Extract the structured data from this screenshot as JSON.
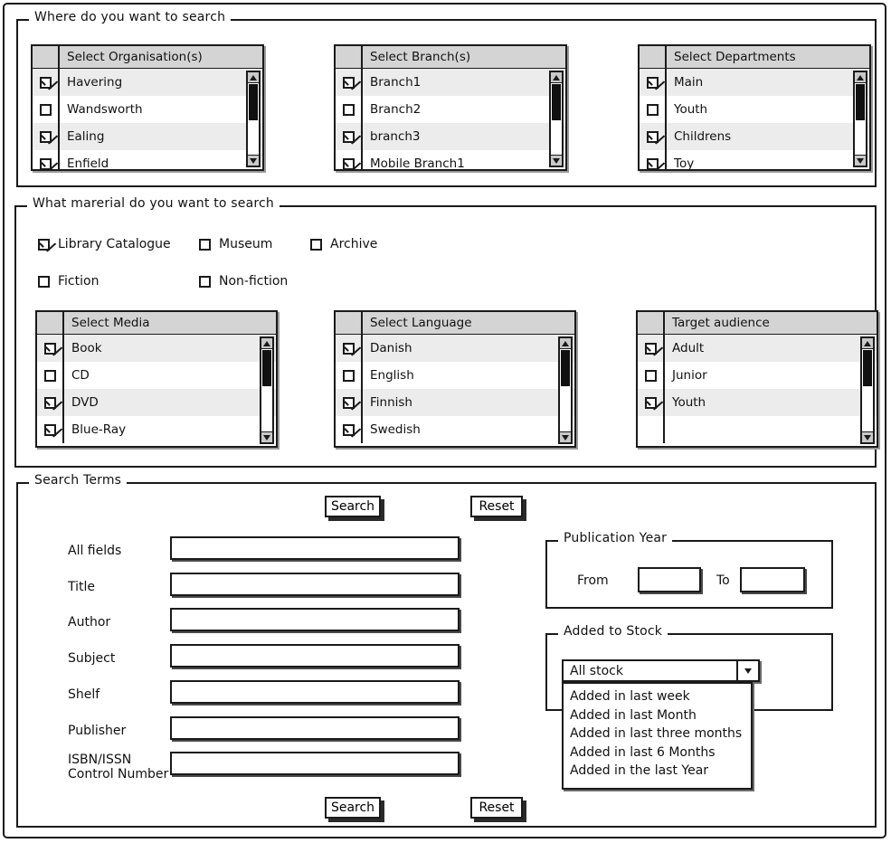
{
  "sections": {
    "where": {
      "legend": "Where do you want to search"
    },
    "material": {
      "legend": "What marerial do you want to search"
    },
    "terms": {
      "legend": "Search Terms"
    },
    "pubyear": {
      "legend": "Publication Year"
    },
    "addedstock": {
      "legend": "Added to Stock"
    }
  },
  "lists": {
    "organisations": {
      "header": "Select Organisation(s)",
      "rows": [
        {
          "label": "Havering",
          "checked": true
        },
        {
          "label": "Wandsworth",
          "checked": false
        },
        {
          "label": "Ealing",
          "checked": true
        },
        {
          "label": "Enfield",
          "checked": true
        }
      ]
    },
    "branches": {
      "header": "Select Branch(s)",
      "rows": [
        {
          "label": "Branch1",
          "checked": true
        },
        {
          "label": "Branch2",
          "checked": false
        },
        {
          "label": "branch3",
          "checked": true
        },
        {
          "label": "Mobile Branch1",
          "checked": true
        }
      ]
    },
    "departments": {
      "header": "Select Departments",
      "rows": [
        {
          "label": "Main",
          "checked": true
        },
        {
          "label": "Youth",
          "checked": false
        },
        {
          "label": "Childrens",
          "checked": true
        },
        {
          "label": "Toy",
          "checked": true
        }
      ]
    },
    "media": {
      "header": "Select Media",
      "rows": [
        {
          "label": "Book",
          "checked": true
        },
        {
          "label": "CD",
          "checked": false
        },
        {
          "label": "DVD",
          "checked": true
        },
        {
          "label": "Blue-Ray",
          "checked": true
        }
      ]
    },
    "language": {
      "header": "Select Language",
      "rows": [
        {
          "label": "Danish",
          "checked": true
        },
        {
          "label": "English",
          "checked": false
        },
        {
          "label": "Finnish",
          "checked": true
        },
        {
          "label": "Swedish",
          "checked": true
        }
      ]
    },
    "audience": {
      "header": "Target audience",
      "rows": [
        {
          "label": "Adult",
          "checked": true
        },
        {
          "label": "Junior",
          "checked": false
        },
        {
          "label": "Youth",
          "checked": true
        },
        {
          "label": "",
          "checked": null
        }
      ]
    }
  },
  "material_options": [
    {
      "label": "Library Catalogue",
      "checked": true
    },
    {
      "label": "Museum",
      "checked": false
    },
    {
      "label": "Archive",
      "checked": false
    },
    {
      "label": "Fiction",
      "checked": false
    },
    {
      "label": "Non-fiction",
      "checked": false
    }
  ],
  "buttons": {
    "search_top": "Search",
    "reset_top": "Reset",
    "search_bottom": "Search",
    "reset_bottom": "Reset"
  },
  "fields": [
    {
      "label": "All fields",
      "label2": "",
      "value": ""
    },
    {
      "label": "Title",
      "label2": "",
      "value": ""
    },
    {
      "label": "Author",
      "label2": "",
      "value": ""
    },
    {
      "label": "Subject",
      "label2": "",
      "value": ""
    },
    {
      "label": "Shelf",
      "label2": "",
      "value": ""
    },
    {
      "label": "Publisher",
      "label2": "",
      "value": ""
    },
    {
      "label": "ISBN/ISSN",
      "label2": "Control Number",
      "value": ""
    }
  ],
  "publication_year": {
    "from_label": "From",
    "to_label": "To",
    "from_value": "",
    "to_value": ""
  },
  "added_to_stock": {
    "selected": "All stock",
    "options": [
      "Added in last week",
      "Added in last Month",
      "Added in last three months",
      "Added in last 6 Months",
      "Added in the last Year"
    ]
  },
  "colors": {
    "ink": "#1a1a1a",
    "header_fill": "#d4d4d4",
    "row_alt": "#ececec",
    "page": "#ffffff"
  }
}
